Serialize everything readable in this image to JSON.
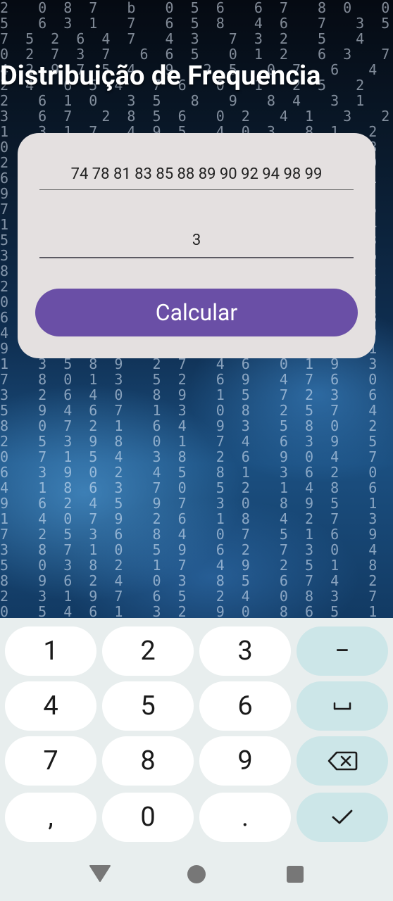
{
  "title": "Distribuição de Frequencia",
  "form": {
    "data_input_value": "74 78 81 83 85 88 89 90 92 94 98 99",
    "classes_input_value": "3",
    "calculate_label": "Calcular"
  },
  "keyboard": {
    "rows": [
      [
        "1",
        "2",
        "3",
        "−"
      ],
      [
        "4",
        "5",
        "6",
        "␣"
      ],
      [
        "7",
        "8",
        "9",
        "⌫"
      ],
      [
        ",",
        "0",
        ".",
        "✓"
      ]
    ]
  },
  "background_digits": [
    "2  0 8 7  b  0 5 6  6 7  8 0  0 2 6  8",
    "5  6 3 1  7  6 5 8  4 6  7  3 5  7 3 4",
    "7 5 2 6 4 7  4 3  7 3 2  5  4  6 3  7",
    "0 2 7 3 7  6 6 5  0 1 2  6 3  7 9  5 7",
    "4 2 9 7 5 4  9  2 5  0 7  6  4 3  1  5",
    "2 4  6 5 4  7 6  0  1  2 5  2  1  7  6",
    "2  6 1 0  3 5  8  9  8 4  3 1  6 4  8",
    "3  6 7  2 8 5 6  0 2  4 1  3  2 0  8 6",
    "1  3 1 7  4 9 5  4 0 3  8 1  2  7 5 0",
    "0  4 9 8 2  3 6  7 5  9 4 0  8 2  1 3",
    "2  8 5 3 1  0 7  4 6  3 9 1  0  5 2 4",
    "6  1 0 2 4  9 3  5 7  8 6  2 1  4 3 9",
    "9 4 2  3 6 7 0  1 5  2 8 4  9  3 6 0",
    "7  3 5 1 9  2 4  6 8  0 3 7  5  1 4 2",
    "1  8 6 4 0  5 9  3 2  7 1 6  4  9 0 5",
    "5  2 7 9 3  8 1  0 4  6 2 5  3  8 7 1",
    "3  9 0 6 8  1 5  7 2  4 9 0  6  2 5 8",
    "8  0 4 2 7  6 3  9 1  5 0 8  2  7 3 6",
    "2  5 1 8 4  3 0  2 6  9 7 1  5  4 8 3",
    "0  7 3 5 1  9 6  8 4  2 3 0  7  6 1 9",
    "6  4 8 0 2  7 5  1 9  3 6 4  8  0 2 7",
    "4  1 9 7 6  0 8  5 3  1 4 2  9  6 7 0",
    "9  6 2 3 5  4 1  7 0  8 5 3  1  2 9 4",
    "1  3 5 8 9  2 7  4 6  0 1 9  3  5 8 2",
    "7  8 0 1 3  5 2  6 9  4 7 6  0  1 3 5",
    "3  2 6 4 0  8 9  1 5  7 2 3  6  9 0 1",
    "5  9 4 6 7  1 3  0 8  2 5 7  4  3 6 8",
    "8  0 7 2 1  6 4  9 3  5 8 0  2  7 1 4",
    "2  5 3 9 8  0 1  7 4  6 3 9  5  8 4 2",
    "0  7 1 5 4  3 8  2 6  9 0 4  7  1 5 3",
    "6  3 9 0 2  4 5  8 1  3 6 2  0  9 7 5",
    "4  1 8 6 3  7 0  5 2  1 4 8  6  3 2 0",
    "9  6 2 4 5  9 7  3 0  8 9 5  1  4 6 7",
    "1  4 0 7 9  2 6  1 8  4 2 7  3  5 0 6",
    "7  2 5 3 6  8 4  0 7  5 1 6  9  2 8 3",
    "3  8 7 1 0  5 9  6 2  7 3 0  4  6 1 9",
    "5  0 3 8 2  1 7  4 9  2 5 1  8  0 3 4",
    "8  9 6 2 4  0 3  8 5  6 7 4  2  1 9 0",
    "2  3 1 9 7  6 5  2 4  0 8 3  7  9 6 1",
    "0  5 4 6 1  3 2  9 0  8 6 5  1  3 4 7"
  ]
}
